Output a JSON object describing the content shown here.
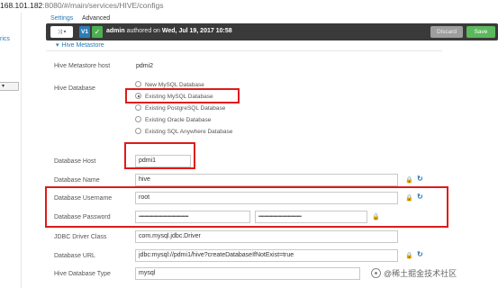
{
  "browser": {
    "url_host": "168.101.182",
    "url_path": ":8080/#/main/services/HIVE/configs"
  },
  "sidebar": {
    "link_fragment": "rics"
  },
  "tabs": {
    "settings": "Settings",
    "advanced": "Advanced"
  },
  "version_bar": {
    "dropdown_icon": "shuffle-icon",
    "version": "V1",
    "check_icon": "check-icon",
    "author": "admin",
    "authored_text": "authored on",
    "date": "Wed, Jul 19, 2017 10:58",
    "discard_label": "Discard",
    "save_label": "Save"
  },
  "section": {
    "title": "Hive Metastore"
  },
  "form": {
    "metastore_host": {
      "label": "Hive Metastore host",
      "value": "pdmi2"
    },
    "database": {
      "label": "Hive Database",
      "options": [
        {
          "label": "New MySQL Database",
          "selected": false
        },
        {
          "label": "Existing MySQL Database",
          "selected": true
        },
        {
          "label": "Existing PostgreSQL Database",
          "selected": false
        },
        {
          "label": "Existing Oracle Database",
          "selected": false
        },
        {
          "label": "Existing SQL Anywhere Database",
          "selected": false
        }
      ]
    },
    "db_host": {
      "label": "Database Host",
      "value": "pdmi1"
    },
    "db_name": {
      "label": "Database Name",
      "value": "hive"
    },
    "db_username": {
      "label": "Database Username",
      "value": "root"
    },
    "db_password": {
      "label": "Database Password",
      "value": "••••••••••••••••••••••••••••••••••••••••••••",
      "confirm": "••••••••••••••••••••••••••••••••••••••"
    },
    "jdbc_driver": {
      "label": "JDBC Driver Class",
      "value": "com.mysql.jdbc.Driver"
    },
    "db_url": {
      "label": "Database URL",
      "value": "jdbc:mysql://pdmi1/hive?createDatabaseIfNotExist=true"
    },
    "db_type": {
      "label": "Hive Database Type",
      "value": "mysql"
    }
  },
  "icons": {
    "lock": "lock-icon",
    "refresh": "refresh-icon"
  },
  "colors": {
    "accent": "#2a7ab8",
    "highlight": "#e01a1a",
    "save": "#5cb85c",
    "bar": "#3a3a3a"
  },
  "watermark": "@稀土掘金技术社区"
}
